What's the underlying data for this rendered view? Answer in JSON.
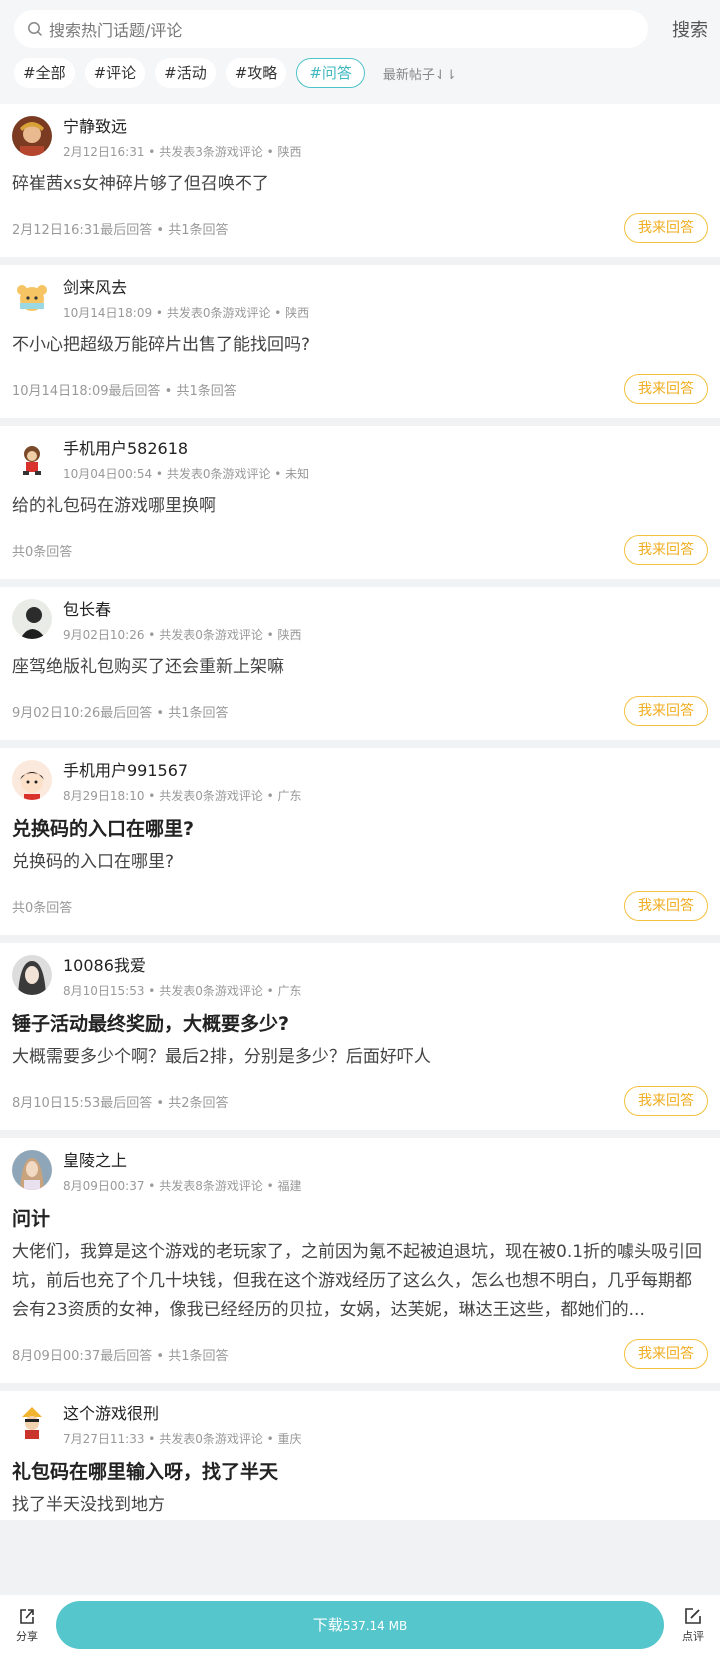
{
  "search": {
    "placeholder": "搜索热门话题/评论",
    "button": "搜索"
  },
  "tags": [
    "#全部",
    "#评论",
    "#活动",
    "#攻略",
    "#问答"
  ],
  "sort_label": "最新帖子⇃⇂",
  "answer_label": "我来回答",
  "posts": [
    {
      "user": "宁静致远",
      "meta": "2月12日16:31 • 共发表3条游戏评论 • 陕西",
      "title": "",
      "content": "碎崔茜xs女神碎片够了但召唤不了",
      "footer": "2月12日16:31最后回答 • 共1条回答"
    },
    {
      "user": "剑来风去",
      "meta": "10月14日18:09 • 共发表0条游戏评论 • 陕西",
      "title": "",
      "content": "不小心把超级万能碎片出售了能找回吗?",
      "footer": "10月14日18:09最后回答 • 共1条回答"
    },
    {
      "user": "手机用户582618",
      "meta": "10月04日00:54 • 共发表0条游戏评论 • 未知",
      "title": "",
      "content": "给的礼包码在游戏哪里换啊",
      "footer": "共0条回答"
    },
    {
      "user": "包长春",
      "meta": "9月02日10:26 • 共发表0条游戏评论 • 陕西",
      "title": "",
      "content": "座驾绝版礼包购买了还会重新上架嘛",
      "footer": "9月02日10:26最后回答 • 共1条回答"
    },
    {
      "user": "手机用户991567",
      "meta": "8月29日18:10 • 共发表0条游戏评论 • 广东",
      "title": "兑换码的入口在哪里?",
      "content": "兑换码的入口在哪里?",
      "footer": "共0条回答"
    },
    {
      "user": "10086我爱",
      "meta": "8月10日15:53 • 共发表0条游戏评论 • 广东",
      "title": "锤子活动最终奖励，大概要多少?",
      "content": "大概需要多少个啊？最后2排，分别是多少？后面好吓人",
      "footer": "8月10日15:53最后回答 • 共2条回答"
    },
    {
      "user": "皇陵之上",
      "meta": "8月09日00:37 • 共发表8条游戏评论 • 福建",
      "title": "问计",
      "content": "大佬们，我算是这个游戏的老玩家了，之前因为氪不起被迫退坑，现在被0.1折的噱头吸引回坑，前后也充了个几十块钱，但我在这个游戏经历了这么久，怎么也想不明白，几乎每期都会有23资质的女神，像我已经经历的贝拉，女娲，达芙妮，琳达王这些，都她们的...",
      "footer": "8月09日00:37最后回答 • 共1条回答"
    },
    {
      "user": "这个游戏很刑",
      "meta": "7月27日11:33 • 共发表0条游戏评论 • 重庆",
      "title": "礼包码在哪里输入呀，找了半天",
      "content": "找了半天没找到地方",
      "footer": ""
    }
  ],
  "bottom": {
    "share": "分享",
    "download": "下载",
    "size": "537.14 MB",
    "review": "点评"
  },
  "colors": {
    "accent": "#55c6cc",
    "answer": "#f3c13f"
  }
}
